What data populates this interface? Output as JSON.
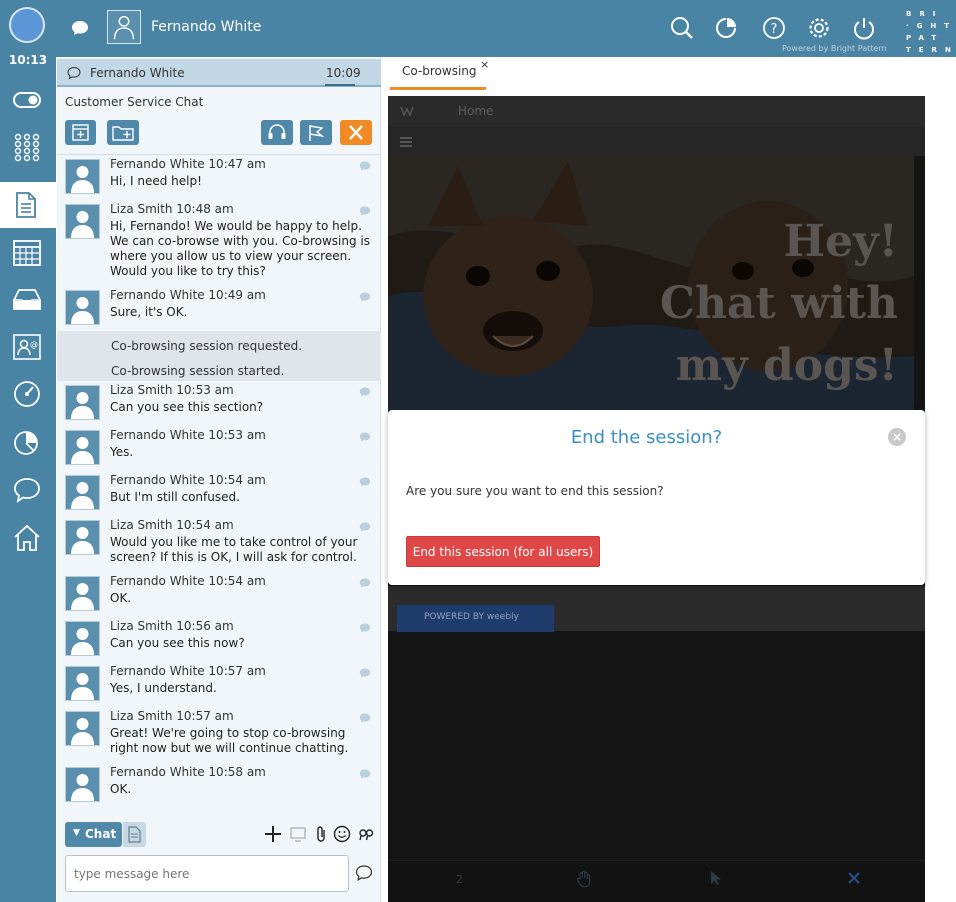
{
  "header": {
    "agent_name": "Fernando White",
    "brand_lines": [
      "BRI",
      "·GHT",
      "PAT",
      "TERN"
    ],
    "powered_by": "Powered by Bright Pattern",
    "top_icons": [
      "search-icon",
      "reports-icon",
      "help-icon",
      "settings-icon",
      "logout-icon"
    ]
  },
  "sidebar": {
    "time": "10:13",
    "items": [
      "toggle-icon",
      "dialpad-icon",
      "documents-icon",
      "calendar-icon",
      "inbox-icon",
      "contacts-icon",
      "dashboard-icon",
      "stats-icon",
      "chat-icon",
      "home-icon"
    ]
  },
  "chat": {
    "tab_name": "Fernando White",
    "tab_time": "10:09",
    "title": "Customer Service Chat",
    "controls": [
      "schedule-icon",
      "folder-add-icon",
      "headset-icon",
      "flag-icon",
      "close-icon"
    ],
    "messages": [
      {
        "name": "Fernando White",
        "time": "10:47 am",
        "text": "Hi, I need help!"
      },
      {
        "name": "Liza Smith",
        "time": "10:48 am",
        "text": "Hi, Fernando! We would be happy to help. We can co-browse with you. Co-browsing is where you allow us to view your screen. Would you like to try this?"
      },
      {
        "name": "Fernando White",
        "time": "10:49 am",
        "text": "Sure, it's OK."
      },
      {
        "name": "Liza Smith",
        "time": "10:53 am",
        "text": "Can you see this section?"
      },
      {
        "name": "Fernando White",
        "time": "10:53 am",
        "text": "Yes."
      },
      {
        "name": "Fernando White",
        "time": "10:54 am",
        "text": "But I'm still confused."
      },
      {
        "name": "Liza Smith",
        "time": "10:54 am",
        "text": "Would you like me to take control of your screen? If this is OK, I will ask for control."
      },
      {
        "name": "Fernando White",
        "time": "10:54 am",
        "text": "OK."
      },
      {
        "name": "Liza Smith",
        "time": "10:56 am",
        "text": "Can you see this now?"
      },
      {
        "name": "Fernando White",
        "time": "10:57 am",
        "text": "Yes, I understand."
      },
      {
        "name": "Liza Smith",
        "time": "10:57 am",
        "text": "Great! We're going to stop co-browsing right now but we will continue chatting."
      },
      {
        "name": "Fernando White",
        "time": "10:58 am",
        "text": "OK."
      }
    ],
    "system": [
      "Co-browsing session requested.",
      "Co-browsing session started."
    ],
    "footer_tab": "Chat",
    "input_placeholder": "type message here"
  },
  "cobrowse": {
    "tab_label": "Co-browsing",
    "tab_close": "×",
    "site_nav_home": "Home",
    "hero_text": "Hey! Chat with my dogs!",
    "badge": "POWERED BY  weebly",
    "toolbar_number": "2"
  },
  "dialog": {
    "title": "End the session?",
    "close": "×",
    "message": "Are you sure you want to end this session?",
    "button": "End this session (for all users)"
  },
  "colors": {
    "primary": "#4a84a4",
    "accent": "#f08a24",
    "danger": "#e04848",
    "dialog_title": "#3a8fc6"
  }
}
